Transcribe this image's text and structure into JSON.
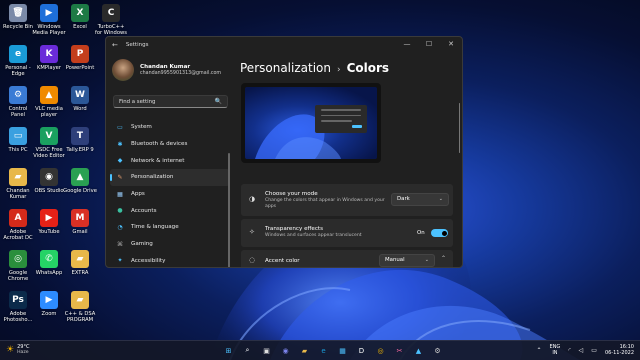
{
  "desktop_icons": [
    {
      "label": "Recycle Bin",
      "icon": "recycle-bin-icon",
      "color": "#7a8aa8",
      "glyph": "🗑"
    },
    {
      "label": "Windows Media Player",
      "icon": "media-player-icon",
      "color": "#1e6fd9",
      "glyph": "▶"
    },
    {
      "label": "Excel",
      "icon": "excel-icon",
      "color": "#1d7a45",
      "glyph": "X"
    },
    {
      "label": "TurboC++ for Windows 7",
      "icon": "turboc-icon",
      "color": "#2a2a2a",
      "glyph": "C"
    },
    {
      "label": "Personal - Edge",
      "icon": "edge-icon",
      "color": "#1a9bd7",
      "glyph": "e"
    },
    {
      "label": "KMPlayer",
      "icon": "kmplayer-icon",
      "color": "#6a2bd9",
      "glyph": "K"
    },
    {
      "label": "PowerPoint",
      "icon": "powerpoint-icon",
      "color": "#c43e1c",
      "glyph": "P"
    },
    {
      "label": "Control Panel",
      "icon": "control-panel-icon",
      "color": "#3a7bd5",
      "glyph": "⚙"
    },
    {
      "label": "VLC media player",
      "icon": "vlc-icon",
      "color": "#f08a00",
      "glyph": "▲"
    },
    {
      "label": "Word",
      "icon": "word-icon",
      "color": "#2b5797",
      "glyph": "W"
    },
    {
      "label": "This PC",
      "icon": "this-pc-icon",
      "color": "#3aa0e0",
      "glyph": "▭"
    },
    {
      "label": "VSDC Free Video Editor",
      "icon": "vsdc-icon",
      "color": "#1aa060",
      "glyph": "V"
    },
    {
      "label": "Tally.ERP 9",
      "icon": "tally-icon",
      "color": "#2e3f7a",
      "glyph": "T"
    },
    {
      "label": "Chandan Kumar",
      "icon": "user-folder-icon",
      "color": "#e8b84a",
      "glyph": "▰"
    },
    {
      "label": "OBS Studio",
      "icon": "obs-icon",
      "color": "#333333",
      "glyph": "◉"
    },
    {
      "label": "Google Drive",
      "icon": "google-drive-icon",
      "color": "#2aa052",
      "glyph": "▲"
    },
    {
      "label": "Adobe Acrobat DC",
      "icon": "acrobat-icon",
      "color": "#d42a1a",
      "glyph": "A"
    },
    {
      "label": "YouTube",
      "icon": "youtube-icon",
      "color": "#e62117",
      "glyph": "▶"
    },
    {
      "label": "Gmail",
      "icon": "gmail-icon",
      "color": "#d93025",
      "glyph": "M"
    },
    {
      "label": "Google Chrome",
      "icon": "chrome-icon",
      "color": "#2a8f3c",
      "glyph": "◎"
    },
    {
      "label": "WhatsApp",
      "icon": "whatsapp-icon",
      "color": "#25d366",
      "glyph": "✆"
    },
    {
      "label": "EXTRA",
      "icon": "folder-icon",
      "color": "#e8b84a",
      "glyph": "▰"
    },
    {
      "label": "Adobe Photosho...",
      "icon": "photoshop-icon",
      "color": "#0b2a4a",
      "glyph": "Ps"
    },
    {
      "label": "Zoom",
      "icon": "zoom-icon",
      "color": "#2d8cff",
      "glyph": "▶"
    },
    {
      "label": "C++ & DSA PROGRAM",
      "icon": "folder-icon",
      "color": "#e8b84a",
      "glyph": "▰"
    }
  ],
  "window": {
    "title": "Settings",
    "back_glyph": "←",
    "controls": {
      "minimize": "—",
      "maximize": "☐",
      "close": "✕"
    }
  },
  "profile": {
    "name": "Chandan Kumar",
    "email": "chandan9955901313@gmail.com"
  },
  "search": {
    "placeholder": "Find a setting",
    "icon": "🔍"
  },
  "nav": [
    {
      "label": "System",
      "icon": "system-icon",
      "glyph": "▭",
      "color": "#4cc2ff",
      "active": false
    },
    {
      "label": "Bluetooth & devices",
      "icon": "bluetooth-icon",
      "glyph": "✱",
      "color": "#4cc2ff",
      "active": false
    },
    {
      "label": "Network & internet",
      "icon": "wifi-icon",
      "glyph": "◆",
      "color": "#4cc2ff",
      "active": false
    },
    {
      "label": "Personalization",
      "icon": "brush-icon",
      "glyph": "✎",
      "color": "#e8a070",
      "active": true
    },
    {
      "label": "Apps",
      "icon": "apps-icon",
      "glyph": "▦",
      "color": "#9ad0ff",
      "active": false
    },
    {
      "label": "Accounts",
      "icon": "accounts-icon",
      "glyph": "●",
      "color": "#3ac0a0",
      "active": false
    },
    {
      "label": "Time & language",
      "icon": "globe-clock-icon",
      "glyph": "◔",
      "color": "#4cc2ff",
      "active": false
    },
    {
      "label": "Gaming",
      "icon": "gaming-icon",
      "glyph": "⌘",
      "color": "#aaaaaa",
      "active": false
    },
    {
      "label": "Accessibility",
      "icon": "accessibility-icon",
      "glyph": "✦",
      "color": "#4cc2ff",
      "active": false
    }
  ],
  "breadcrumb": {
    "parent": "Personalization",
    "separator": "›",
    "current": "Colors"
  },
  "settings": {
    "mode": {
      "title": "Choose your mode",
      "desc": "Change the colors that appear in Windows and your apps",
      "value": "Dark",
      "icon": "palette-icon",
      "glyph": "◑"
    },
    "transparency": {
      "title": "Transparency effects",
      "desc": "Windows and surfaces appear translucent",
      "state_label": "On",
      "on": true,
      "icon": "transparency-icon",
      "glyph": "✧"
    },
    "accent": {
      "title": "Accent color",
      "value": "Manual",
      "icon": "accent-icon",
      "glyph": "◌"
    }
  },
  "taskbar": {
    "weather": {
      "temp": "29°C",
      "cond": "Haze"
    },
    "apps": [
      {
        "icon": "start-icon",
        "glyph": "⊞",
        "color": "#4cc2ff"
      },
      {
        "icon": "search-taskbar-icon",
        "glyph": "⌕",
        "color": "#ffffff"
      },
      {
        "icon": "task-view-icon",
        "glyph": "▣",
        "color": "#dddddd"
      },
      {
        "icon": "chat-icon",
        "glyph": "◉",
        "color": "#7b83eb"
      },
      {
        "icon": "file-explorer-icon",
        "glyph": "▰",
        "color": "#e8b84a"
      },
      {
        "icon": "edge-taskbar-icon",
        "glyph": "e",
        "color": "#1a9bd7"
      },
      {
        "icon": "store-icon",
        "glyph": "▦",
        "color": "#4cc2ff"
      },
      {
        "icon": "dell-icon",
        "glyph": "D",
        "color": "#ffffff"
      },
      {
        "icon": "chrome-taskbar-icon",
        "glyph": "◎",
        "color": "#f2b600"
      },
      {
        "icon": "snipping-icon",
        "glyph": "✂",
        "color": "#ff6aa0"
      },
      {
        "icon": "photos-icon",
        "glyph": "▲",
        "color": "#4cc2ff"
      },
      {
        "icon": "settings-taskbar-icon",
        "glyph": "⚙",
        "color": "#cccccc"
      }
    ],
    "lang_top": "ENG",
    "lang_bottom": "IN",
    "time": "16:10",
    "date": "06-11-2022"
  }
}
